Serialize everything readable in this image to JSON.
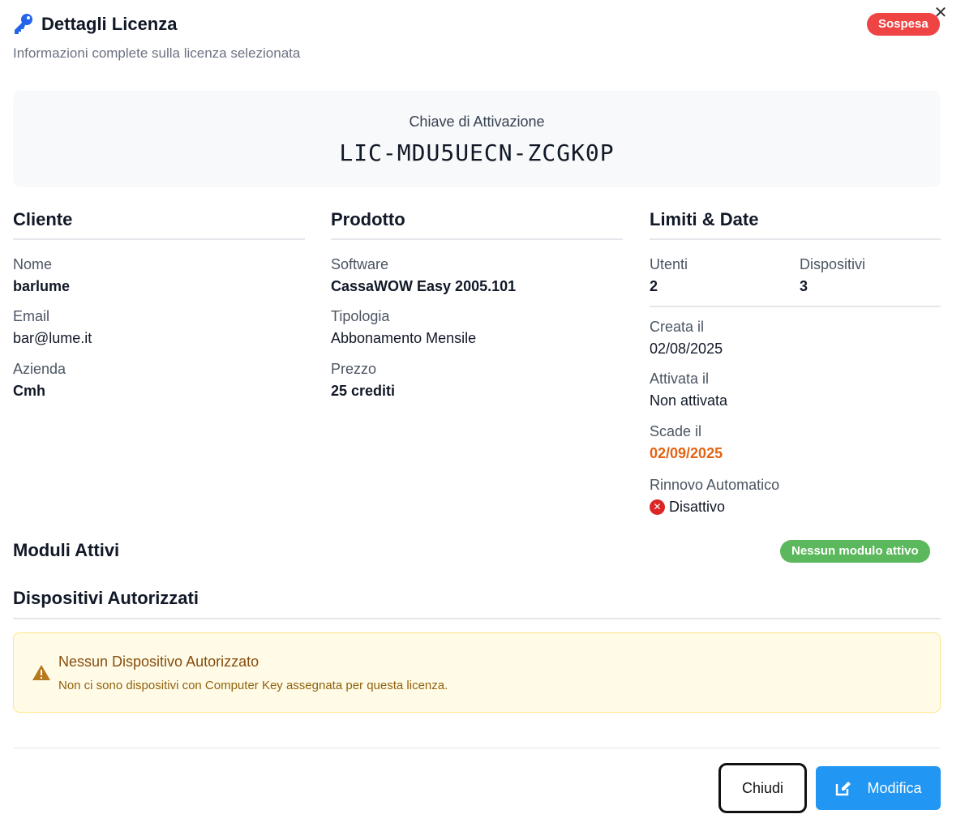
{
  "header": {
    "title": "Dettagli Licenza",
    "subtitle": "Informazioni complete sulla licenza selezionata",
    "status": "Sospesa",
    "close_glyph": "✕",
    "icon": "key-icon"
  },
  "key": {
    "label": "Chiave di Attivazione",
    "code": "LIC-MDU5UECN-ZCGK0P"
  },
  "cliente": {
    "heading": "Cliente",
    "fields": [
      {
        "label": "Nome",
        "value": "barlume"
      },
      {
        "label": "Email",
        "value": "bar@lume.it"
      },
      {
        "label": "Azienda",
        "value": "Cmh"
      }
    ]
  },
  "prodotto": {
    "heading": "Prodotto",
    "fields": [
      {
        "label": "Software",
        "value": "CassaWOW Easy 2005.101"
      },
      {
        "label": "Tipologia",
        "value": "Abbonamento Mensile"
      },
      {
        "label": "Prezzo",
        "value": "25 crediti"
      }
    ]
  },
  "limiti": {
    "heading": "Limiti & Date",
    "utenti": {
      "label": "Utenti",
      "value": "2"
    },
    "dispositivi": {
      "label": "Dispositivi",
      "value": "3"
    },
    "creata": {
      "label": "Creata il",
      "value": "02/08/2025"
    },
    "attivata": {
      "label": "Attivata il",
      "value": "Non attivata"
    },
    "scade": {
      "label": "Scade il",
      "value": "02/09/2025"
    },
    "rinnovo": {
      "label": "Rinnovo Automatico",
      "value": "Disattivo"
    }
  },
  "moduli": {
    "heading": "Moduli Attivi",
    "badge": "Nessun modulo attivo"
  },
  "dispositivi_autorizzati": {
    "heading": "Dispositivi Autorizzati",
    "alert_title": "Nessun Dispositivo Autorizzato",
    "alert_text": "Non ci sono dispositivi con Computer Key assegnata per questa licenza."
  },
  "footer": {
    "close_label": "Chiudi",
    "edit_label": "Modifica"
  },
  "colors": {
    "status_suspended": "#ef4444",
    "modules_badge": "#5cb85c",
    "expiry_date": "#e36414",
    "primary_button": "#2196f3",
    "alert_background": "#fffbe6"
  }
}
